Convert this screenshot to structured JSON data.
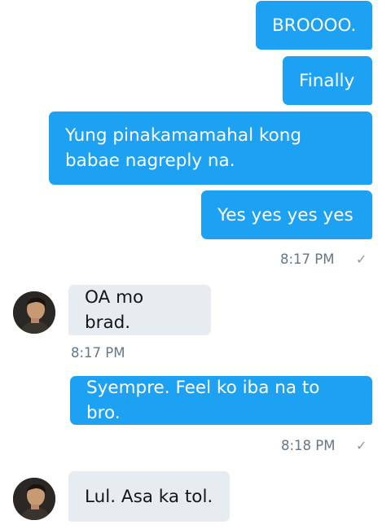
{
  "conversation": {
    "messages": [
      {
        "text": "BROOOO."
      },
      {
        "text": "Finally"
      },
      {
        "text": "Yung pinakamamahal kong babae nagreply na."
      },
      {
        "text": "Yes yes yes yes"
      },
      {
        "text": "OA mo brad."
      },
      {
        "text": "Syempre. Feel ko iba na to bro."
      },
      {
        "text": "Lul. Asa ka tol."
      }
    ],
    "timestamps": [
      {
        "time": "8:17 PM"
      },
      {
        "time": "8:17 PM"
      },
      {
        "time": "8:18 PM"
      }
    ],
    "sent_check": "✓"
  },
  "colors": {
    "outgoing_bubble": "#1da1f2",
    "incoming_bubble": "#e6ecf0",
    "timestamp": "#657786"
  }
}
